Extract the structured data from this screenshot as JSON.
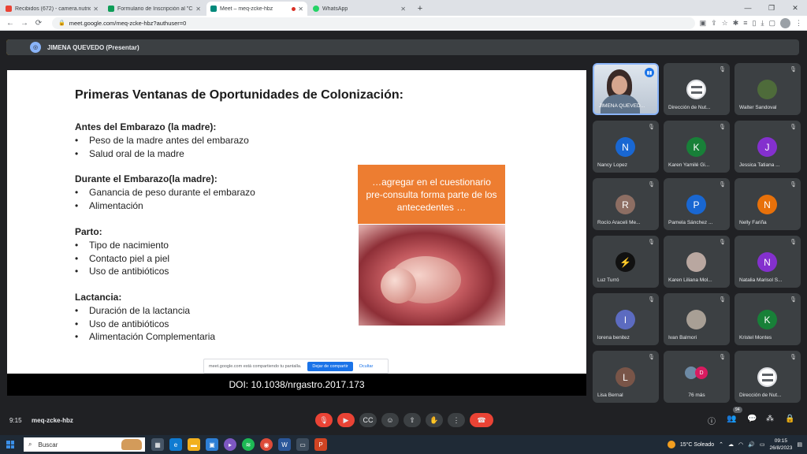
{
  "browser": {
    "tabs": [
      {
        "title": "Recibidos (672) - camera.nutricion...",
        "favicon_color": "#ea4335",
        "active": false
      },
      {
        "title": "Formulario de Inscripción al \"Cu...",
        "favicon_color": "#0f9d58",
        "active": false
      },
      {
        "title": "Meet – meq-zcke-hbz",
        "favicon_color": "#00897b",
        "active": true
      },
      {
        "title": "WhatsApp",
        "favicon_color": "#25d366",
        "active": false
      }
    ],
    "new_tab": "+",
    "window_controls": {
      "minimize": "—",
      "restore": "❐",
      "close": "✕"
    },
    "url": "meet.google.com/meq-zcke-hbz?authuser=0"
  },
  "meet": {
    "presenter": "JIMENA QUEVEDO (Presentar)",
    "slide": {
      "title": "Primeras Ventanas de Oportunidades de Colonización:",
      "sections": [
        {
          "heading": "Antes del Embarazo (la madre):",
          "items": [
            "Peso de la madre antes del embarazo",
            "Salud oral de la madre"
          ]
        },
        {
          "heading": "Durante el Embarazo(la madre):",
          "items": [
            "Ganancia de peso durante el embarazo",
            "Alimentación"
          ]
        },
        {
          "heading": "Parto:",
          "items": [
            "Tipo de nacimiento",
            "Contacto piel a piel",
            "Uso de antibióticos"
          ]
        },
        {
          "heading": "Lactancia:",
          "items": [
            "Duración de la lactancia",
            "Uso de antibióticos",
            "Alimentación Complementaria"
          ]
        }
      ],
      "callout": "…agregar en el cuestionario pre-consulta forma parte de los antecedentes …",
      "doi": "DOI: 10.1038/nrgastro.2017.173"
    },
    "share_bar": {
      "message": "meet.google.com está compartiendo tu pantalla.",
      "stop_button": "Dejar de compartir",
      "hide_link": "Ocultar"
    },
    "participants": [
      {
        "name": "JIMENA QUEVED...",
        "initial": "",
        "color": "",
        "kind": "camera"
      },
      {
        "name": "Dirección de Nut...",
        "initial": "",
        "color": "#ffffff",
        "kind": "logo"
      },
      {
        "name": "Walter Sandoval",
        "initial": "",
        "color": "#4e6b3a",
        "kind": "photo"
      },
      {
        "name": "Nancy Lopez",
        "initial": "N",
        "color": "#1967d2",
        "kind": "initial"
      },
      {
        "name": "Karen Yamilé Gi...",
        "initial": "K",
        "color": "#188038",
        "kind": "initial"
      },
      {
        "name": "Jessica Tatiana ...",
        "initial": "J",
        "color": "#8430ce",
        "kind": "initial"
      },
      {
        "name": "Rocío Araceli Me...",
        "initial": "R",
        "color": "#8d6e63",
        "kind": "initial"
      },
      {
        "name": "Pamela Sánchez ...",
        "initial": "P",
        "color": "#1967d2",
        "kind": "initial"
      },
      {
        "name": "Nelly Fariña",
        "initial": "N",
        "color": "#e8710a",
        "kind": "initial"
      },
      {
        "name": "Luz Turró",
        "initial": "",
        "color": "#111111",
        "kind": "photo"
      },
      {
        "name": "Karen Liliana Mol...",
        "initial": "",
        "color": "#b9a7a0",
        "kind": "photo"
      },
      {
        "name": "Natalia Marisol S...",
        "initial": "N",
        "color": "#8430ce",
        "kind": "initial"
      },
      {
        "name": "lorena benitez",
        "initial": "l",
        "color": "#5c6bc0",
        "kind": "initial"
      },
      {
        "name": "Ivan Balmori",
        "initial": "",
        "color": "#a89f95",
        "kind": "photo"
      },
      {
        "name": "Kristel Montes",
        "initial": "K",
        "color": "#188038",
        "kind": "initial"
      },
      {
        "name": "Lisa Bernal",
        "initial": "L",
        "color": "#795548",
        "kind": "initial"
      },
      {
        "name": "76 más",
        "initial": "D",
        "color": "#d81b60",
        "kind": "more"
      },
      {
        "name": "Dirección de Nut...",
        "initial": "",
        "color": "#ffffff",
        "kind": "logo"
      }
    ],
    "bottom": {
      "time": "9:15",
      "meeting_code": "meq-zcke-hbz",
      "participant_count": "94"
    }
  },
  "taskbar": {
    "search_placeholder": "Buscar",
    "weather": "15°C  Soleado",
    "time": "09:15",
    "date": "26/8/2023"
  }
}
